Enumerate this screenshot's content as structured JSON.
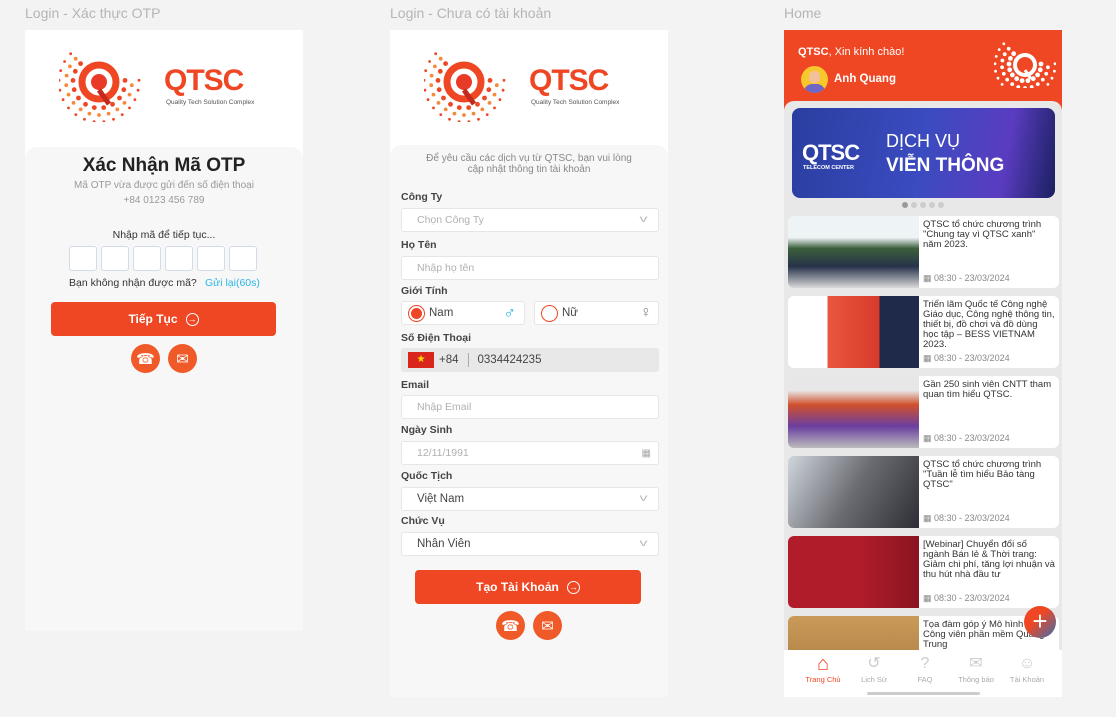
{
  "frames": {
    "otp": "Login - Xác thực OTP",
    "register": "Login - Chưa có tài khoản",
    "home": "Home"
  },
  "logo": {
    "brand": "QTSC",
    "tagline": "Quality Tech Solution Complex"
  },
  "otp": {
    "title": "Xác Nhận Mã OTP",
    "subtitle": "Mã OTP vừa được gửi đến số điện thoại",
    "phone": "+84 0123 456 789",
    "prompt": "Nhập mã để tiếp tục...",
    "resend_question": "Bạn không nhận được mã?",
    "resend_link": "Gửi lại(60s)",
    "continue_label": "Tiếp Tục"
  },
  "register": {
    "intro": "Để yêu cầu các dịch vụ từ QTSC, bạn vui lòng cập nhật thông tin tài khoản",
    "company_label": "Công Ty",
    "company_placeholder": "Chọn Công Ty",
    "name_label": "Họ Tên",
    "name_placeholder": "Nhập họ tên",
    "gender_label": "Giới Tính",
    "gender_male": "Nam",
    "gender_female": "Nữ",
    "gender_selected": "Nam",
    "phone_label": "Số Điện Thoại",
    "phone_code": "+84",
    "phone_value": "0334424235",
    "email_label": "Email",
    "email_placeholder": "Nhập Email",
    "dob_label": "Ngày Sinh",
    "dob_placeholder": "12/11/1991",
    "nationality_label": "Quốc Tịch",
    "nationality_value": "Việt Nam",
    "position_label": "Chức Vụ",
    "position_value": "Nhân Viên",
    "submit_label": "Tạo Tài Khoản"
  },
  "home": {
    "greeting_brand": "QTSC",
    "greeting": ", Xin kính chào!",
    "user": "Anh Quang",
    "banner": {
      "brand": "QTSC",
      "sub": "TELECOM CENTER",
      "line1": "DỊCH VỤ",
      "line2": "VIỄN THÔNG",
      "slides": 5,
      "active": 0
    },
    "news": [
      {
        "title": "QTSC tổ chức chương trình \"Chung tay vì QTSC xanh\" năm 2023.",
        "date": "08:30 - 23/03/2024"
      },
      {
        "title": "Triển lãm Quốc tế Công nghệ Giáo dục, Công nghệ thông tin, thiết bị, đồ chơi và đồ dùng học tập – BESS VIETNAM 2023.",
        "date": "08:30 - 23/03/2024"
      },
      {
        "title": "Gần 250 sinh viên CNTT tham quan tìm hiểu QTSC.",
        "date": "08:30 - 23/03/2024"
      },
      {
        "title": "QTSC tổ chức chương trình \"Tuần lễ tìm hiểu Bảo tàng QTSC\"",
        "date": "08:30 - 23/03/2024"
      },
      {
        "title": "[Webinar] Chuyển đổi số ngành Bán lẻ & Thời trang: Giảm chi phí, tăng lợi nhuận và thu hút nhà đầu tư",
        "date": "08:30 - 23/03/2024"
      },
      {
        "title": "Tọa đàm góp ý Mô hình Chuỗi Công viên phần mềm Quang Trung",
        "date": ""
      }
    ],
    "nav": [
      {
        "label": "Trang Chủ",
        "icon": "home-icon"
      },
      {
        "label": "Lịch Sử",
        "icon": "history-icon"
      },
      {
        "label": "FAQ",
        "icon": "faq-icon"
      },
      {
        "label": "Thông báo",
        "icon": "mail-icon"
      },
      {
        "label": "Tài Khoản",
        "icon": "account-icon"
      }
    ],
    "nav_active": 0
  },
  "colors": {
    "accent": "#ef4623",
    "link": "#29b6e8"
  }
}
